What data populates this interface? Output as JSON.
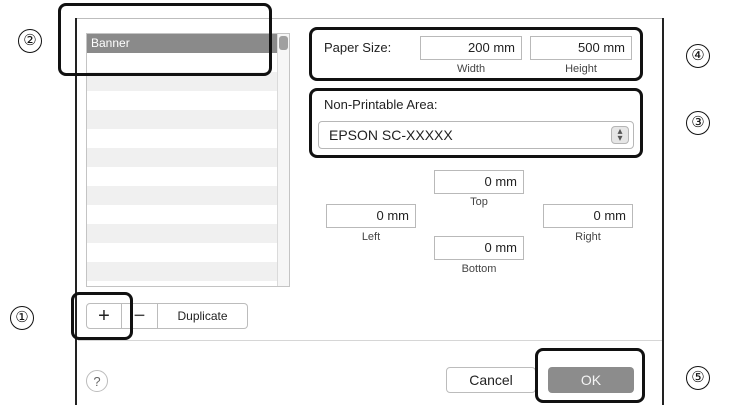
{
  "list": {
    "items": [
      "Banner",
      "",
      "",
      "",
      "",
      "",
      "",
      "",
      "",
      "",
      "",
      "",
      ""
    ],
    "selected_index": 0
  },
  "list_buttons": {
    "add": "+",
    "remove": "−",
    "duplicate": "Duplicate"
  },
  "paper_size": {
    "label": "Paper Size:",
    "width": "200 mm",
    "width_label": "Width",
    "height": "500 mm",
    "height_label": "Height"
  },
  "non_printable": {
    "label": "Non-Printable Area:",
    "printer": "EPSON SC-XXXXX",
    "top": "0 mm",
    "top_label": "Top",
    "left": "0 mm",
    "left_label": "Left",
    "right": "0 mm",
    "right_label": "Right",
    "bottom": "0 mm",
    "bottom_label": "Bottom"
  },
  "footer": {
    "help": "?",
    "cancel": "Cancel",
    "ok": "OK"
  },
  "callouts": [
    "①",
    "②",
    "③",
    "④",
    "⑤"
  ]
}
